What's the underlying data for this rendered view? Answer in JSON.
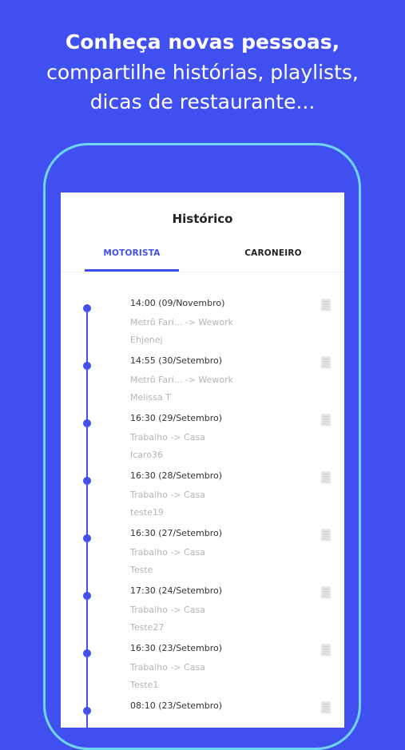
{
  "promo": {
    "line1": "Conheça novas pessoas,",
    "line2": "compartilhe histórias, playlists,",
    "line3": "dicas de restaurante..."
  },
  "screen": {
    "title": "Histórico",
    "tabs": [
      {
        "label": "MOTORISTA",
        "active": true
      },
      {
        "label": "CARONEIRO",
        "active": false
      }
    ]
  },
  "history": [
    {
      "time": "14:00 (09/Novembro)",
      "route": "Metrô Fari... -> Wework",
      "user": "Ehjenej"
    },
    {
      "time": "14:55 (30/Setembro)",
      "route": "Metrô Fari... -> Wework",
      "user": "Melissa T"
    },
    {
      "time": "16:30 (29/Setembro)",
      "route": "Trabalho -> Casa",
      "user": "Icaro36"
    },
    {
      "time": "16:30 (28/Setembro)",
      "route": "Trabalho -> Casa",
      "user": "teste19"
    },
    {
      "time": "16:30 (27/Setembro)",
      "route": "Trabalho -> Casa",
      "user": "Teste"
    },
    {
      "time": "17:30 (24/Setembro)",
      "route": "Trabalho -> Casa",
      "user": "Teste27"
    },
    {
      "time": "16:30 (23/Setembro)",
      "route": "Trabalho -> Casa",
      "user": "Teste1"
    },
    {
      "time": "08:10 (23/Setembro)",
      "route": "",
      "user": ""
    }
  ],
  "colors": {
    "background": "#4050F0",
    "accent": "#4050F0",
    "phone_outline": "#6fd6f2"
  },
  "icons": {
    "timeline_dot": "timeline-dot",
    "receipt": "receipt-icon"
  }
}
